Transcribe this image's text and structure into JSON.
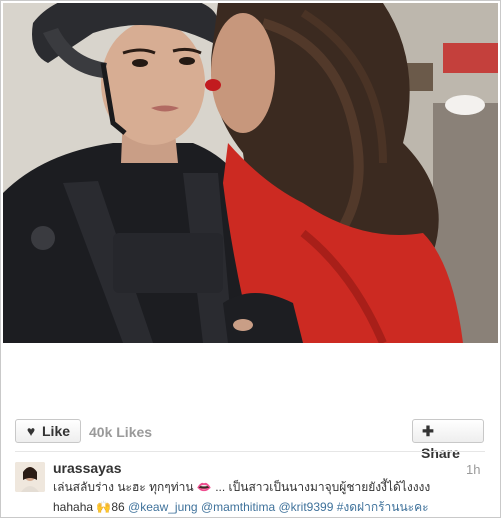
{
  "post": {
    "actions": {
      "like_label": "Like",
      "like_icon": "heart-icon",
      "likes_count": "40k Likes",
      "share_label": "Share",
      "share_icon": "plus-icon"
    },
    "caption": {
      "username": "urassayas",
      "timestamp": "1h",
      "line1_text": "เล่นสลับร่าง นะฮะ ทุกๆท่าน",
      "lips_emoji": "lips-emoji",
      "line1_rest": "... เป็นสาวเป็นนางมาจุบผู้ชายยังงี้ได้ไงงงง",
      "line2_start": "hahaha",
      "hands_emoji": "raised-hands-emoji",
      "line2_number": "86",
      "mentions": [
        "@keaw_jung",
        "@mamthitima",
        "@krit9399"
      ],
      "hashtag": "#งดฝากร้านนะคะ"
    },
    "colors": {
      "link": "#3f729b",
      "muted": "#9a9a9a",
      "text": "#333333"
    }
  }
}
